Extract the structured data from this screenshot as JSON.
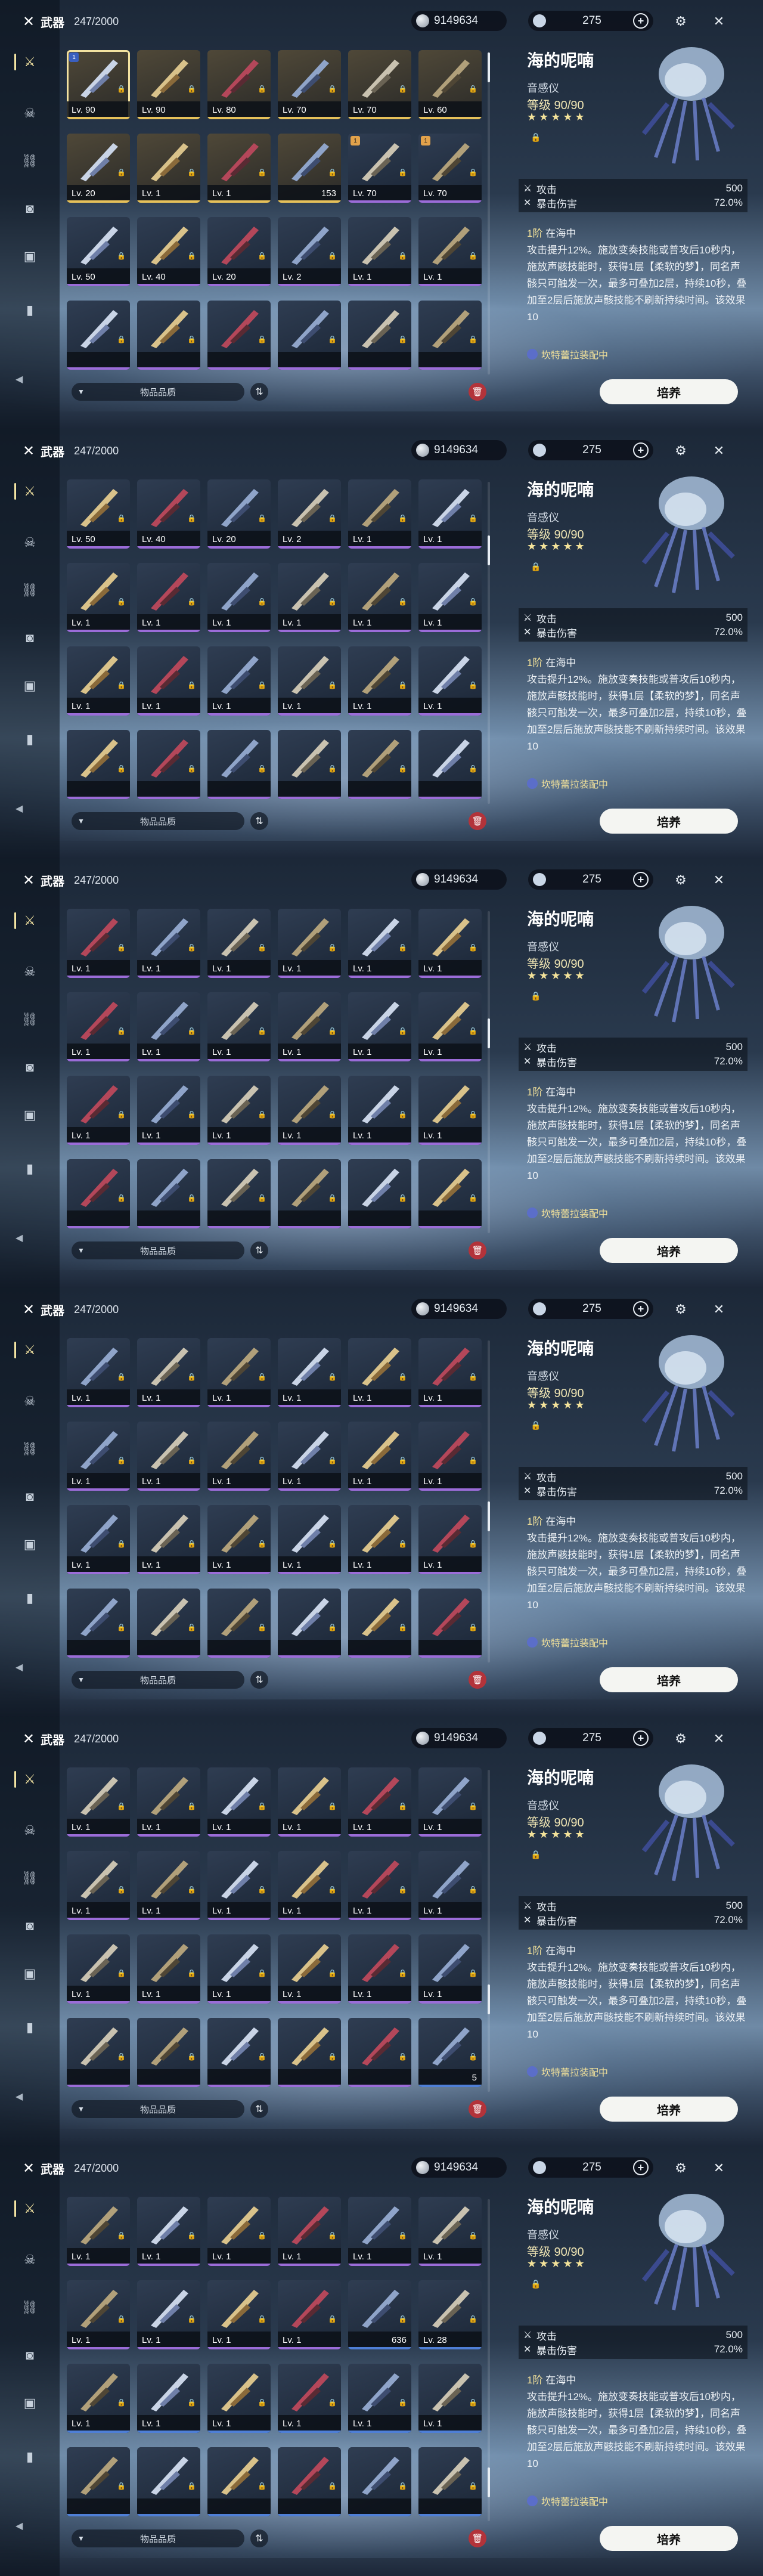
{
  "header": {
    "title": "武器",
    "count": "247/2000"
  },
  "currency": {
    "amount": "9149634"
  },
  "stamina": {
    "value": "275",
    "plus": "+"
  },
  "detail": {
    "name": "海的呢喃",
    "type": "音感仪",
    "level_label": "等级 90/90",
    "stars": "★★★★★",
    "stat1_label": "攻击",
    "stat1_value": "500",
    "stat2_label": "暴击伤害",
    "stat2_value": "72.0%",
    "rank": "1阶",
    "skill_name": "在海中",
    "desc": "攻击提升12%。施放变奏技能或普攻后10秒内，施放声骸技能时，获得1层【柔软的梦】，同名声骸只可触发一次，最多可叠加2层，持续10秒，叠加至2层后施放声骸技能不刷新持续时间。该效果10",
    "equipped": "坎特蕾拉装配中"
  },
  "footer": {
    "sort_label": "物品品质",
    "upgrade_label": "培养"
  },
  "icons": {
    "weapon": "crossed-swords-icon",
    "echo": "mask-icon",
    "chain": "chain-icon",
    "camera": "camera-icon",
    "bag": "bag-icon",
    "book": "book-icon",
    "settings": "gear-icon",
    "close": "close-icon",
    "trash": "trash-icon"
  },
  "colors": {
    "rarity5": "#e6c15a",
    "rarity4": "#9b6cd8",
    "rarity3": "#4f7fd6",
    "accent": "#f3e29a",
    "trash": "#b3333a"
  },
  "screens": [
    {
      "rows": [
        [
          {
            "t": "Lv. 90",
            "r": 5,
            "b": "1",
            "sel": true
          },
          {
            "t": "Lv. 90",
            "r": 5
          },
          {
            "t": "Lv. 80",
            "r": 5
          },
          {
            "t": "Lv. 70",
            "r": 5
          },
          {
            "t": "Lv. 70",
            "r": 5
          },
          {
            "t": "Lv. 60",
            "r": 5
          }
        ],
        [
          {
            "t": "Lv. 20",
            "r": 5
          },
          {
            "t": "Lv. 1",
            "r": 5
          },
          {
            "t": "Lv. 1",
            "r": 5
          },
          {
            "t": "153",
            "r": 5,
            "q": true
          },
          {
            "t": "Lv. 70",
            "r": 4,
            "b": "1"
          },
          {
            "t": "Lv. 70",
            "r": 4,
            "b": "1"
          }
        ],
        [
          {
            "t": "Lv. 50",
            "r": 4
          },
          {
            "t": "Lv. 40",
            "r": 4
          },
          {
            "t": "Lv. 20",
            "r": 4
          },
          {
            "t": "Lv. 2",
            "r": 4
          },
          {
            "t": "Lv. 1",
            "r": 4
          },
          {
            "t": "Lv. 1",
            "r": 4
          }
        ],
        [
          {
            "t": "",
            "r": 4
          },
          {
            "t": "",
            "r": 4
          },
          {
            "t": "",
            "r": 4
          },
          {
            "t": "",
            "r": 4
          },
          {
            "t": "",
            "r": 4
          },
          {
            "t": "",
            "r": 4
          }
        ]
      ],
      "thumb": 0
    },
    {
      "rows": [
        [
          {
            "t": "Lv. 50",
            "r": 4
          },
          {
            "t": "Lv. 40",
            "r": 4
          },
          {
            "t": "Lv. 20",
            "r": 4
          },
          {
            "t": "Lv. 2",
            "r": 4
          },
          {
            "t": "Lv. 1",
            "r": 4
          },
          {
            "t": "Lv. 1",
            "r": 4
          }
        ],
        [
          {
            "t": "Lv. 1",
            "r": 4
          },
          {
            "t": "Lv. 1",
            "r": 4
          },
          {
            "t": "Lv. 1",
            "r": 4
          },
          {
            "t": "Lv. 1",
            "r": 4
          },
          {
            "t": "Lv. 1",
            "r": 4
          },
          {
            "t": "Lv. 1",
            "r": 4
          }
        ],
        [
          {
            "t": "Lv. 1",
            "r": 4
          },
          {
            "t": "Lv. 1",
            "r": 4
          },
          {
            "t": "Lv. 1",
            "r": 4
          },
          {
            "t": "Lv. 1",
            "r": 4
          },
          {
            "t": "Lv. 1",
            "r": 4
          },
          {
            "t": "Lv. 1",
            "r": 4
          }
        ],
        [
          {
            "t": "",
            "r": 4
          },
          {
            "t": "",
            "r": 4
          },
          {
            "t": "",
            "r": 4
          },
          {
            "t": "",
            "r": 4
          },
          {
            "t": "",
            "r": 4
          },
          {
            "t": "",
            "r": 4
          }
        ]
      ],
      "thumb": 1
    },
    {
      "rows": [
        [
          {
            "t": "Lv. 1",
            "r": 4
          },
          {
            "t": "Lv. 1",
            "r": 4
          },
          {
            "t": "Lv. 1",
            "r": 4
          },
          {
            "t": "Lv. 1",
            "r": 4
          },
          {
            "t": "Lv. 1",
            "r": 4
          },
          {
            "t": "Lv. 1",
            "r": 4
          }
        ],
        [
          {
            "t": "Lv. 1",
            "r": 4
          },
          {
            "t": "Lv. 1",
            "r": 4
          },
          {
            "t": "Lv. 1",
            "r": 4
          },
          {
            "t": "Lv. 1",
            "r": 4
          },
          {
            "t": "Lv. 1",
            "r": 4
          },
          {
            "t": "Lv. 1",
            "r": 4
          }
        ],
        [
          {
            "t": "Lv. 1",
            "r": 4
          },
          {
            "t": "Lv. 1",
            "r": 4
          },
          {
            "t": "Lv. 1",
            "r": 4
          },
          {
            "t": "Lv. 1",
            "r": 4
          },
          {
            "t": "Lv. 1",
            "r": 4
          },
          {
            "t": "Lv. 1",
            "r": 4
          }
        ],
        [
          {
            "t": "",
            "r": 4
          },
          {
            "t": "",
            "r": 4
          },
          {
            "t": "",
            "r": 4
          },
          {
            "t": "",
            "r": 4
          },
          {
            "t": "",
            "r": 4
          },
          {
            "t": "",
            "r": 4
          }
        ]
      ],
      "thumb": 2
    },
    {
      "rows": [
        [
          {
            "t": "Lv. 1",
            "r": 4
          },
          {
            "t": "Lv. 1",
            "r": 4
          },
          {
            "t": "Lv. 1",
            "r": 4
          },
          {
            "t": "Lv. 1",
            "r": 4
          },
          {
            "t": "Lv. 1",
            "r": 4
          },
          {
            "t": "Lv. 1",
            "r": 4
          }
        ],
        [
          {
            "t": "Lv. 1",
            "r": 4
          },
          {
            "t": "Lv. 1",
            "r": 4
          },
          {
            "t": "Lv. 1",
            "r": 4
          },
          {
            "t": "Lv. 1",
            "r": 4
          },
          {
            "t": "Lv. 1",
            "r": 4
          },
          {
            "t": "Lv. 1",
            "r": 4
          }
        ],
        [
          {
            "t": "Lv. 1",
            "r": 4
          },
          {
            "t": "Lv. 1",
            "r": 4
          },
          {
            "t": "Lv. 1",
            "r": 4
          },
          {
            "t": "Lv. 1",
            "r": 4
          },
          {
            "t": "Lv. 1",
            "r": 4
          },
          {
            "t": "Lv. 1",
            "r": 4
          }
        ],
        [
          {
            "t": "",
            "r": 4
          },
          {
            "t": "",
            "r": 4
          },
          {
            "t": "",
            "r": 4
          },
          {
            "t": "",
            "r": 4
          },
          {
            "t": "",
            "r": 4
          },
          {
            "t": "",
            "r": 4
          }
        ]
      ],
      "thumb": 3
    },
    {
      "rows": [
        [
          {
            "t": "Lv. 1",
            "r": 4
          },
          {
            "t": "Lv. 1",
            "r": 4
          },
          {
            "t": "Lv. 1",
            "r": 4
          },
          {
            "t": "Lv. 1",
            "r": 4
          },
          {
            "t": "Lv. 1",
            "r": 4
          },
          {
            "t": "Lv. 1",
            "r": 4
          }
        ],
        [
          {
            "t": "Lv. 1",
            "r": 4
          },
          {
            "t": "Lv. 1",
            "r": 4
          },
          {
            "t": "Lv. 1",
            "r": 4
          },
          {
            "t": "Lv. 1",
            "r": 4
          },
          {
            "t": "Lv. 1",
            "r": 4
          },
          {
            "t": "Lv. 1",
            "r": 4
          }
        ],
        [
          {
            "t": "Lv. 1",
            "r": 4
          },
          {
            "t": "Lv. 1",
            "r": 4
          },
          {
            "t": "Lv. 1",
            "r": 4
          },
          {
            "t": "Lv. 1",
            "r": 4
          },
          {
            "t": "Lv. 1",
            "r": 4
          },
          {
            "t": "Lv. 1",
            "r": 4
          }
        ],
        [
          {
            "t": "",
            "r": 4
          },
          {
            "t": "",
            "r": 4
          },
          {
            "t": "",
            "r": 4
          },
          {
            "t": "",
            "r": 4
          },
          {
            "t": "",
            "r": 4
          },
          {
            "t": "5",
            "r": 3,
            "q": true
          }
        ]
      ],
      "thumb": 4
    },
    {
      "rows": [
        [
          {
            "t": "Lv. 1",
            "r": 4
          },
          {
            "t": "Lv. 1",
            "r": 4
          },
          {
            "t": "Lv. 1",
            "r": 4
          },
          {
            "t": "Lv. 1",
            "r": 4
          },
          {
            "t": "Lv. 1",
            "r": 4
          },
          {
            "t": "Lv. 1",
            "r": 4
          }
        ],
        [
          {
            "t": "Lv. 1",
            "r": 4
          },
          {
            "t": "Lv. 1",
            "r": 4
          },
          {
            "t": "Lv. 1",
            "r": 4
          },
          {
            "t": "Lv. 1",
            "r": 4
          },
          {
            "t": "636",
            "r": 3,
            "q": true
          },
          {
            "t": "Lv. 28",
            "r": 3
          }
        ],
        [
          {
            "t": "Lv. 1",
            "r": 3
          },
          {
            "t": "Lv. 1",
            "r": 3
          },
          {
            "t": "Lv. 1",
            "r": 3
          },
          {
            "t": "Lv. 1",
            "r": 3
          },
          {
            "t": "Lv. 1",
            "r": 3
          },
          {
            "t": "Lv. 1",
            "r": 3
          }
        ],
        [
          {
            "t": "",
            "r": 3
          },
          {
            "t": "",
            "r": 3
          },
          {
            "t": "",
            "r": 3
          },
          {
            "t": "",
            "r": 3
          },
          {
            "t": "",
            "r": 3
          },
          {
            "t": "",
            "r": 3
          }
        ]
      ],
      "thumb": 5
    }
  ]
}
